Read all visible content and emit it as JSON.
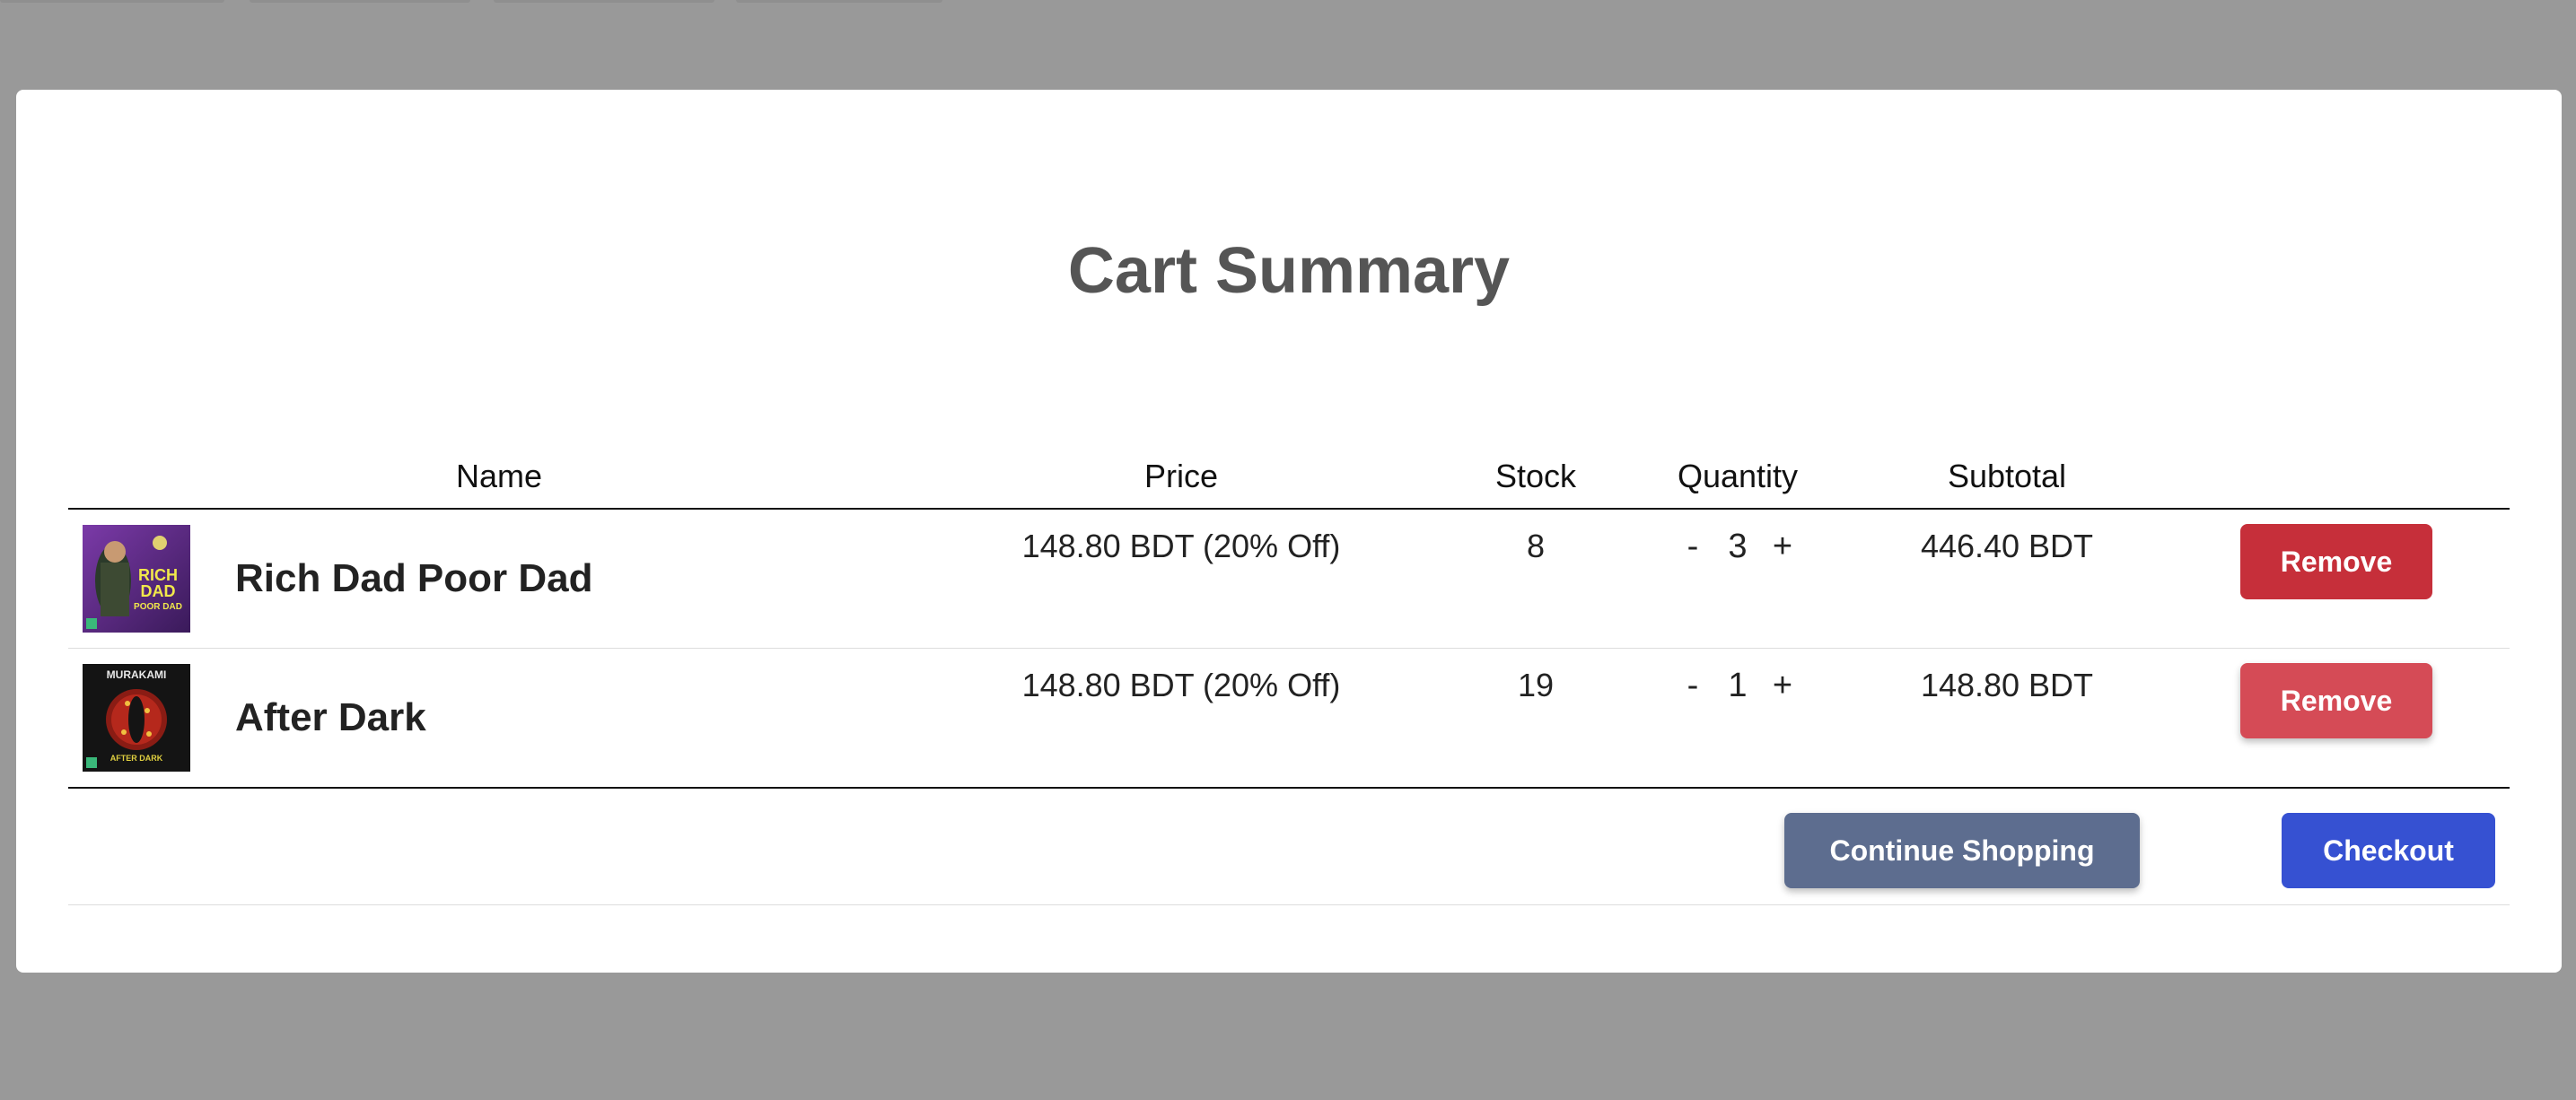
{
  "modal": {
    "title": "Cart Summary"
  },
  "table": {
    "headers": {
      "name": "Name",
      "price": "Price",
      "stock": "Stock",
      "quantity": "Quantity",
      "subtotal": "Subtotal"
    },
    "rows": [
      {
        "name": "Rich Dad Poor Dad",
        "price": "148.80 BDT (20% Off)",
        "stock": "8",
        "quantity": "3",
        "subtotal": "446.40 BDT",
        "remove_label": "Remove",
        "cover": {
          "top_text": "",
          "title_line1": "RICH",
          "title_line2": "DAD",
          "title_line3": "POOR DAD",
          "bg": "#6a2d8f"
        }
      },
      {
        "name": "After Dark",
        "price": "148.80 BDT (20% Off)",
        "stock": "19",
        "quantity": "1",
        "subtotal": "148.80 BDT",
        "remove_label": "Remove",
        "cover": {
          "author": "MURAKAMI",
          "title": "AFTER DARK",
          "bg": "#1a1a1a"
        }
      }
    ],
    "qty_minus": "-",
    "qty_plus": "+"
  },
  "footer": {
    "continue_label": "Continue Shopping",
    "checkout_label": "Checkout"
  },
  "colors": {
    "overlay": "#999999",
    "remove": "#c62f3a",
    "remove_hover": "#d54b56",
    "continue": "#5d6d8f",
    "checkout": "#3651d2",
    "title": "#555555"
  }
}
